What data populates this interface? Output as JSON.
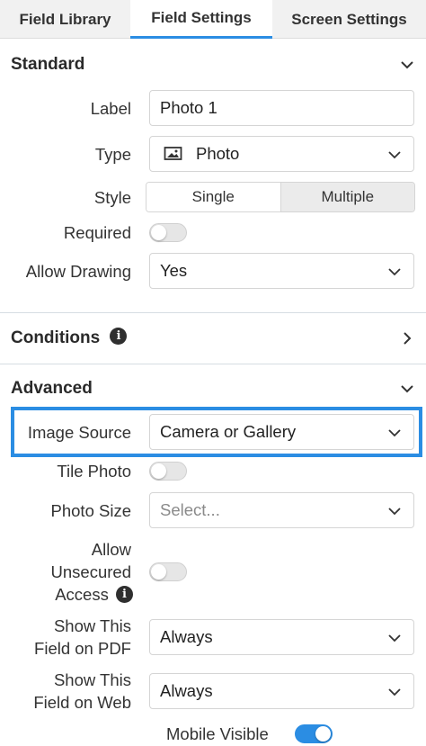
{
  "tabs": [
    {
      "label": "Field Library"
    },
    {
      "label": "Field Settings"
    },
    {
      "label": "Screen Settings"
    }
  ],
  "standard": {
    "title": "Standard",
    "label_label": "Label",
    "label_value": "Photo 1",
    "type_label": "Type",
    "type_value": "Photo",
    "type_icon": "image-icon",
    "style_label": "Style",
    "style_options": [
      "Single",
      "Multiple"
    ],
    "style_selected": "Single",
    "required_label": "Required",
    "required_on": false,
    "allow_drawing_label": "Allow Drawing",
    "allow_drawing_value": "Yes"
  },
  "conditions": {
    "title": "Conditions",
    "info_glyph": "i"
  },
  "advanced": {
    "title": "Advanced",
    "image_source_label": "Image Source",
    "image_source_value": "Camera or Gallery",
    "tile_photo_label": "Tile Photo",
    "tile_photo_on": false,
    "photo_size_label": "Photo Size",
    "photo_size_placeholder": "Select...",
    "unsecured_line1": "Allow",
    "unsecured_line2": "Unsecured",
    "unsecured_line3": "Access",
    "unsecured_on": false,
    "pdf_line1": "Show This",
    "pdf_line2": "Field on PDF",
    "pdf_value": "Always",
    "web_line1": "Show This",
    "web_line2": "Field on Web",
    "web_value": "Always",
    "mobile_label": "Mobile Visible",
    "mobile_on": true,
    "info_glyph": "i"
  },
  "colors": {
    "accent": "#2b8de3",
    "tab_bg": "#f1f1f1"
  }
}
